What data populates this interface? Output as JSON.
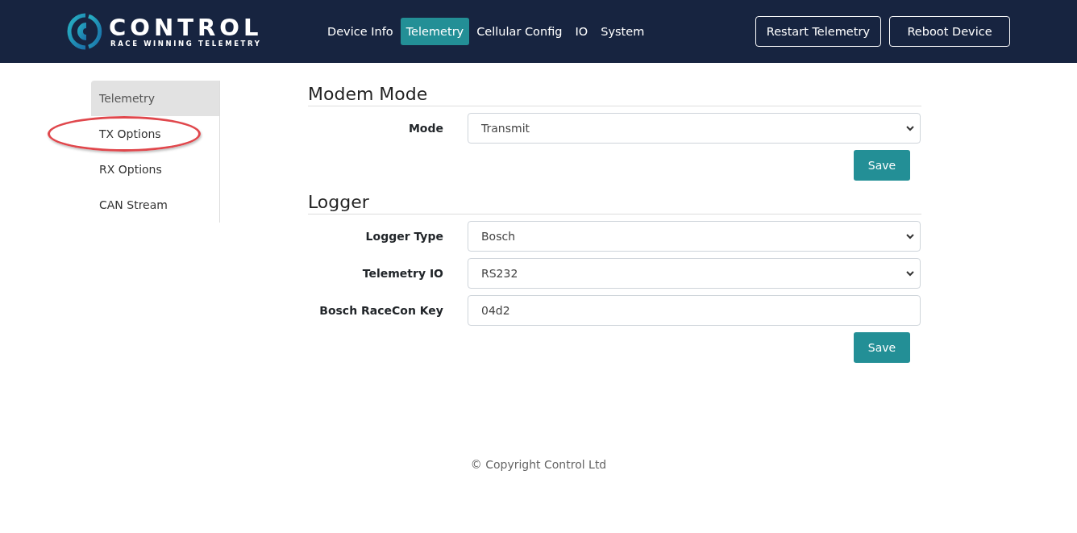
{
  "logo": {
    "name": "CONTROL",
    "tagline": "RACE WINNING TELEMETRY"
  },
  "nav": [
    {
      "label": "Device Info",
      "selected": false
    },
    {
      "label": "Telemetry",
      "selected": true
    },
    {
      "label": "Cellular Config",
      "selected": false
    },
    {
      "label": "IO",
      "selected": false
    },
    {
      "label": "System",
      "selected": false
    }
  ],
  "header_buttons": [
    "Restart Telemetry",
    "Reboot Device"
  ],
  "sidebar": {
    "items": [
      {
        "label": "Telemetry",
        "selected": true,
        "circled": false
      },
      {
        "label": "TX Options",
        "selected": false,
        "circled": true
      },
      {
        "label": "RX Options",
        "selected": false,
        "circled": false
      },
      {
        "label": "CAN Stream",
        "selected": false,
        "circled": false
      }
    ]
  },
  "sections": [
    {
      "title": "Modem Mode",
      "fields": [
        {
          "kind": "select",
          "label": "Mode",
          "value": "Transmit"
        }
      ],
      "button": "Save"
    },
    {
      "title": "Logger",
      "fields": [
        {
          "kind": "select",
          "label": "Logger Type",
          "value": "Bosch"
        },
        {
          "kind": "select",
          "label": "Telemetry IO",
          "value": "RS232"
        },
        {
          "kind": "text",
          "label": "Bosch RaceCon Key",
          "value": "04d2"
        }
      ],
      "button": "Save"
    }
  ],
  "footer": "© Copyright Control Ltd"
}
